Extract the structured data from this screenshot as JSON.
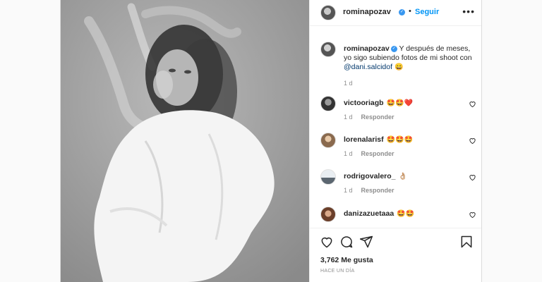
{
  "post": {
    "author": {
      "username": "rominapozav",
      "verified_icon": "verified-badge-icon",
      "dot": "•",
      "follow_label": "Seguir",
      "more_icon": "more-options-icon",
      "more_glyph": "•••"
    },
    "caption": {
      "username": "rominapozav",
      "text": "Y después de meses, yo sigo subiendo fotos de mi shoot con",
      "mention": "@dani.salcidof",
      "emoji": "😄",
      "time": "1 d"
    },
    "comments": [
      {
        "username": "victooriagb",
        "text": "🤩🤩❤️",
        "time": "1 d",
        "reply_label": "Responder"
      },
      {
        "username": "lorenalarisf",
        "text": "🤩🤩🤩",
        "time": "1 d",
        "reply_label": "Responder"
      },
      {
        "username": "rodrigovalero_",
        "text": "👌🏼",
        "time": "1 d",
        "reply_label": "Responder"
      },
      {
        "username": "danizazuetaaa",
        "text": "🤩🤩",
        "time": "",
        "reply_label": ""
      }
    ],
    "actions": {
      "like_icon": "heart-icon",
      "comment_icon": "comment-icon",
      "share_icon": "share-icon",
      "save_icon": "bookmark-icon",
      "likes": "3,762 Me gusta",
      "posted": "HACE UN DÍA"
    },
    "colors": {
      "link": "#0095f6",
      "verified": "#3897f0",
      "muted": "#8e8e8e"
    }
  }
}
